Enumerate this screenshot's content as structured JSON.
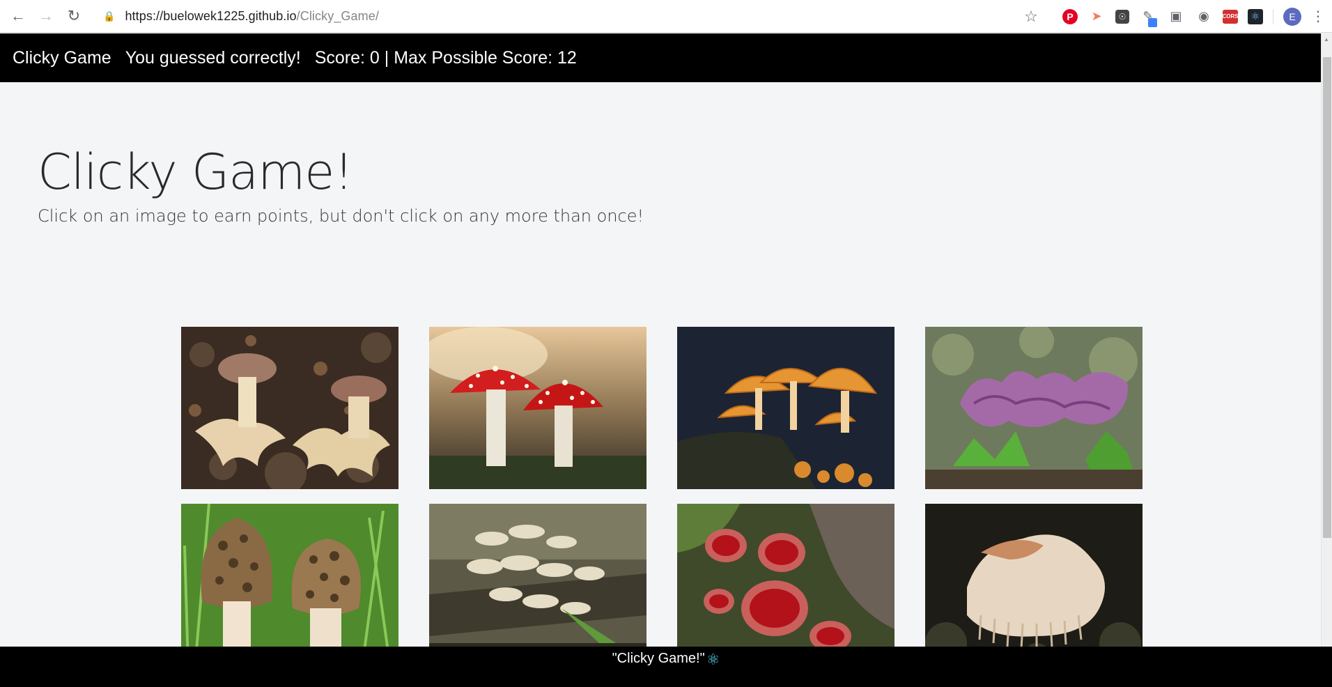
{
  "browser": {
    "url_host": "https://buelowek1225.github.io",
    "url_path": "/Clicky_Game/",
    "avatar_letter": "E",
    "extensions": [
      "star-icon",
      "pinterest-icon",
      "arrow-extension-icon",
      "lightbulb-extension-icon",
      "color-picker-icon",
      "screenshot-icon",
      "code-extension-icon",
      "cors-extension-icon",
      "react-devtools-icon"
    ],
    "cors_label": "CORS"
  },
  "navbar": {
    "brand": "Clicky Game",
    "message": "You guessed correctly!",
    "score": "Score: 0 | Max Possible Score: 12"
  },
  "jumbotron": {
    "title": "Clicky Game!",
    "subtitle": "Click on an image to earn points, but don't click on any more than once!"
  },
  "cards": [
    {
      "name": "earthstar-mushrooms"
    },
    {
      "name": "fly-agaric-mushrooms"
    },
    {
      "name": "orange-pored-mushrooms"
    },
    {
      "name": "purple-chanterelle-mushrooms"
    },
    {
      "name": "morel-mushrooms"
    },
    {
      "name": "white-cluster-mushrooms"
    },
    {
      "name": "scarlet-cup-mushrooms"
    },
    {
      "name": "lions-mane-mushroom"
    }
  ],
  "footer": {
    "text": "\"Clicky Game!\"",
    "icon": "react-icon"
  },
  "colors": {
    "navbar_bg": "#000000",
    "page_bg": "#f4f5f7",
    "react": "#61dafb"
  }
}
